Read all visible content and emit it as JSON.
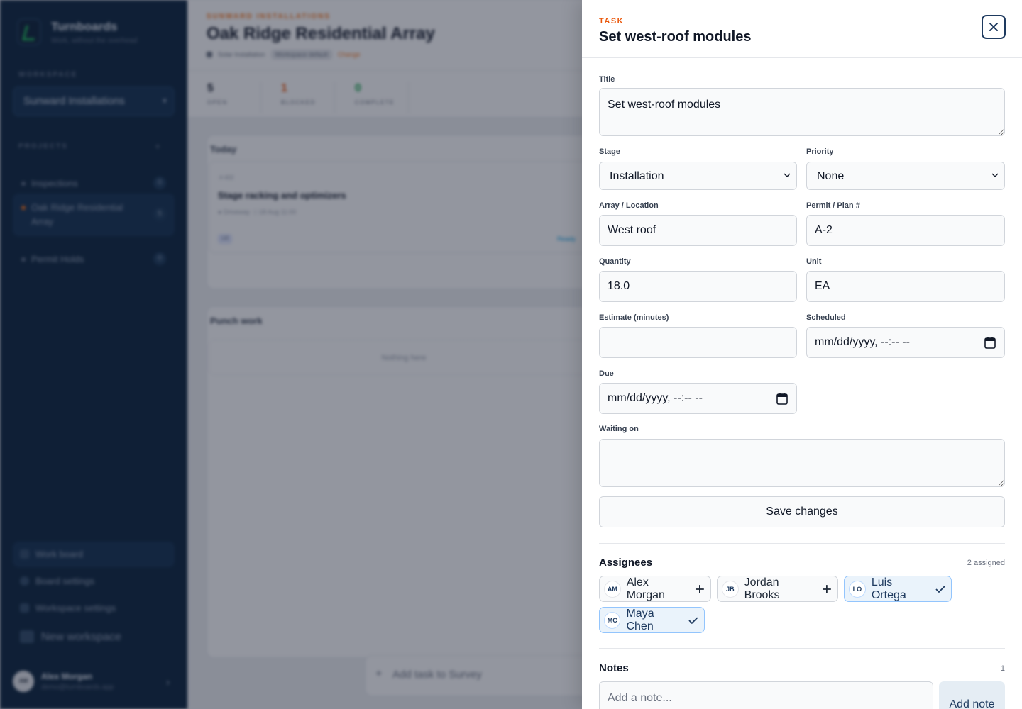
{
  "sidebar": {
    "brand_name": "Turnboards",
    "brand_tagline": "Work, without the overhead",
    "workspace_label": "WORKSPACE",
    "workspace_value": "Sunward Installations",
    "projects_label": "PROJECTS",
    "projects_add": "+",
    "projects": [
      {
        "name": "Inspections",
        "count": "0"
      },
      {
        "name": "Oak Ridge Residential Array",
        "count": "5"
      },
      {
        "name": "Permit Holds",
        "count": "0"
      }
    ],
    "nav": [
      {
        "label": "Work board"
      },
      {
        "label": "Board settings"
      },
      {
        "label": "Workspace settings"
      },
      {
        "label": "New workspace"
      }
    ],
    "user": {
      "initials": "AM",
      "name": "Alex Morgan",
      "email": "demo@turnboards.app"
    }
  },
  "main": {
    "eyebrow": "SUNWARD INSTALLATIONS",
    "title": "Oak Ridge Residential Array",
    "meta_org": "Solar Installation",
    "meta_badge": "Workspace default",
    "meta_change": "Change",
    "stats": [
      {
        "value": "5",
        "label": "OPEN",
        "color": "#111827"
      },
      {
        "value": "1",
        "label": "BLOCKED",
        "color": "#ea580c"
      },
      {
        "value": "0",
        "label": "COMPLETE",
        "color": "#16a34a"
      }
    ],
    "today": {
      "title": "Today",
      "card": {
        "id": "#-402",
        "title": "Stage racking and optimizers",
        "location": "Driveway",
        "date": "18 Aug 11:00",
        "initials": "LO",
        "status": "Ready"
      }
    },
    "punch": {
      "title": "Punch work",
      "empty": "Nothing here"
    },
    "add_task": "Add task to Survey"
  },
  "drawer": {
    "eyebrow": "TASK",
    "title": "Set west-roof modules",
    "fields": {
      "title_label": "Title",
      "title_value": "Set west-roof modules",
      "stage_label": "Stage",
      "stage_value": "Installation",
      "priority_label": "Priority",
      "priority_value": "None",
      "location_label": "Array / Location",
      "location_value": "West roof",
      "permit_label": "Permit / Plan #",
      "permit_value": "A-2",
      "quantity_label": "Quantity",
      "quantity_value": "18.0",
      "unit_label": "Unit",
      "unit_value": "EA",
      "estimate_label": "Estimate (minutes)",
      "estimate_value": "",
      "scheduled_label": "Scheduled",
      "scheduled_value": "mm/dd/yyyy, --:-- --",
      "due_label": "Due",
      "due_value": "mm/dd/yyyy, --:-- --",
      "waiting_label": "Waiting on",
      "waiting_value": ""
    },
    "save_label": "Save changes",
    "assignees": {
      "title": "Assignees",
      "count": "2 assigned",
      "people": [
        {
          "initials": "AM",
          "name": "Alex Morgan",
          "assigned": false
        },
        {
          "initials": "JB",
          "name": "Jordan Brooks",
          "assigned": false
        },
        {
          "initials": "LO",
          "name": "Luis Ortega",
          "assigned": true
        },
        {
          "initials": "MC",
          "name": "Maya Chen",
          "assigned": true
        }
      ]
    },
    "notes": {
      "title": "Notes",
      "count": "1",
      "placeholder": "Add a note...",
      "add_label": "Add note"
    }
  }
}
